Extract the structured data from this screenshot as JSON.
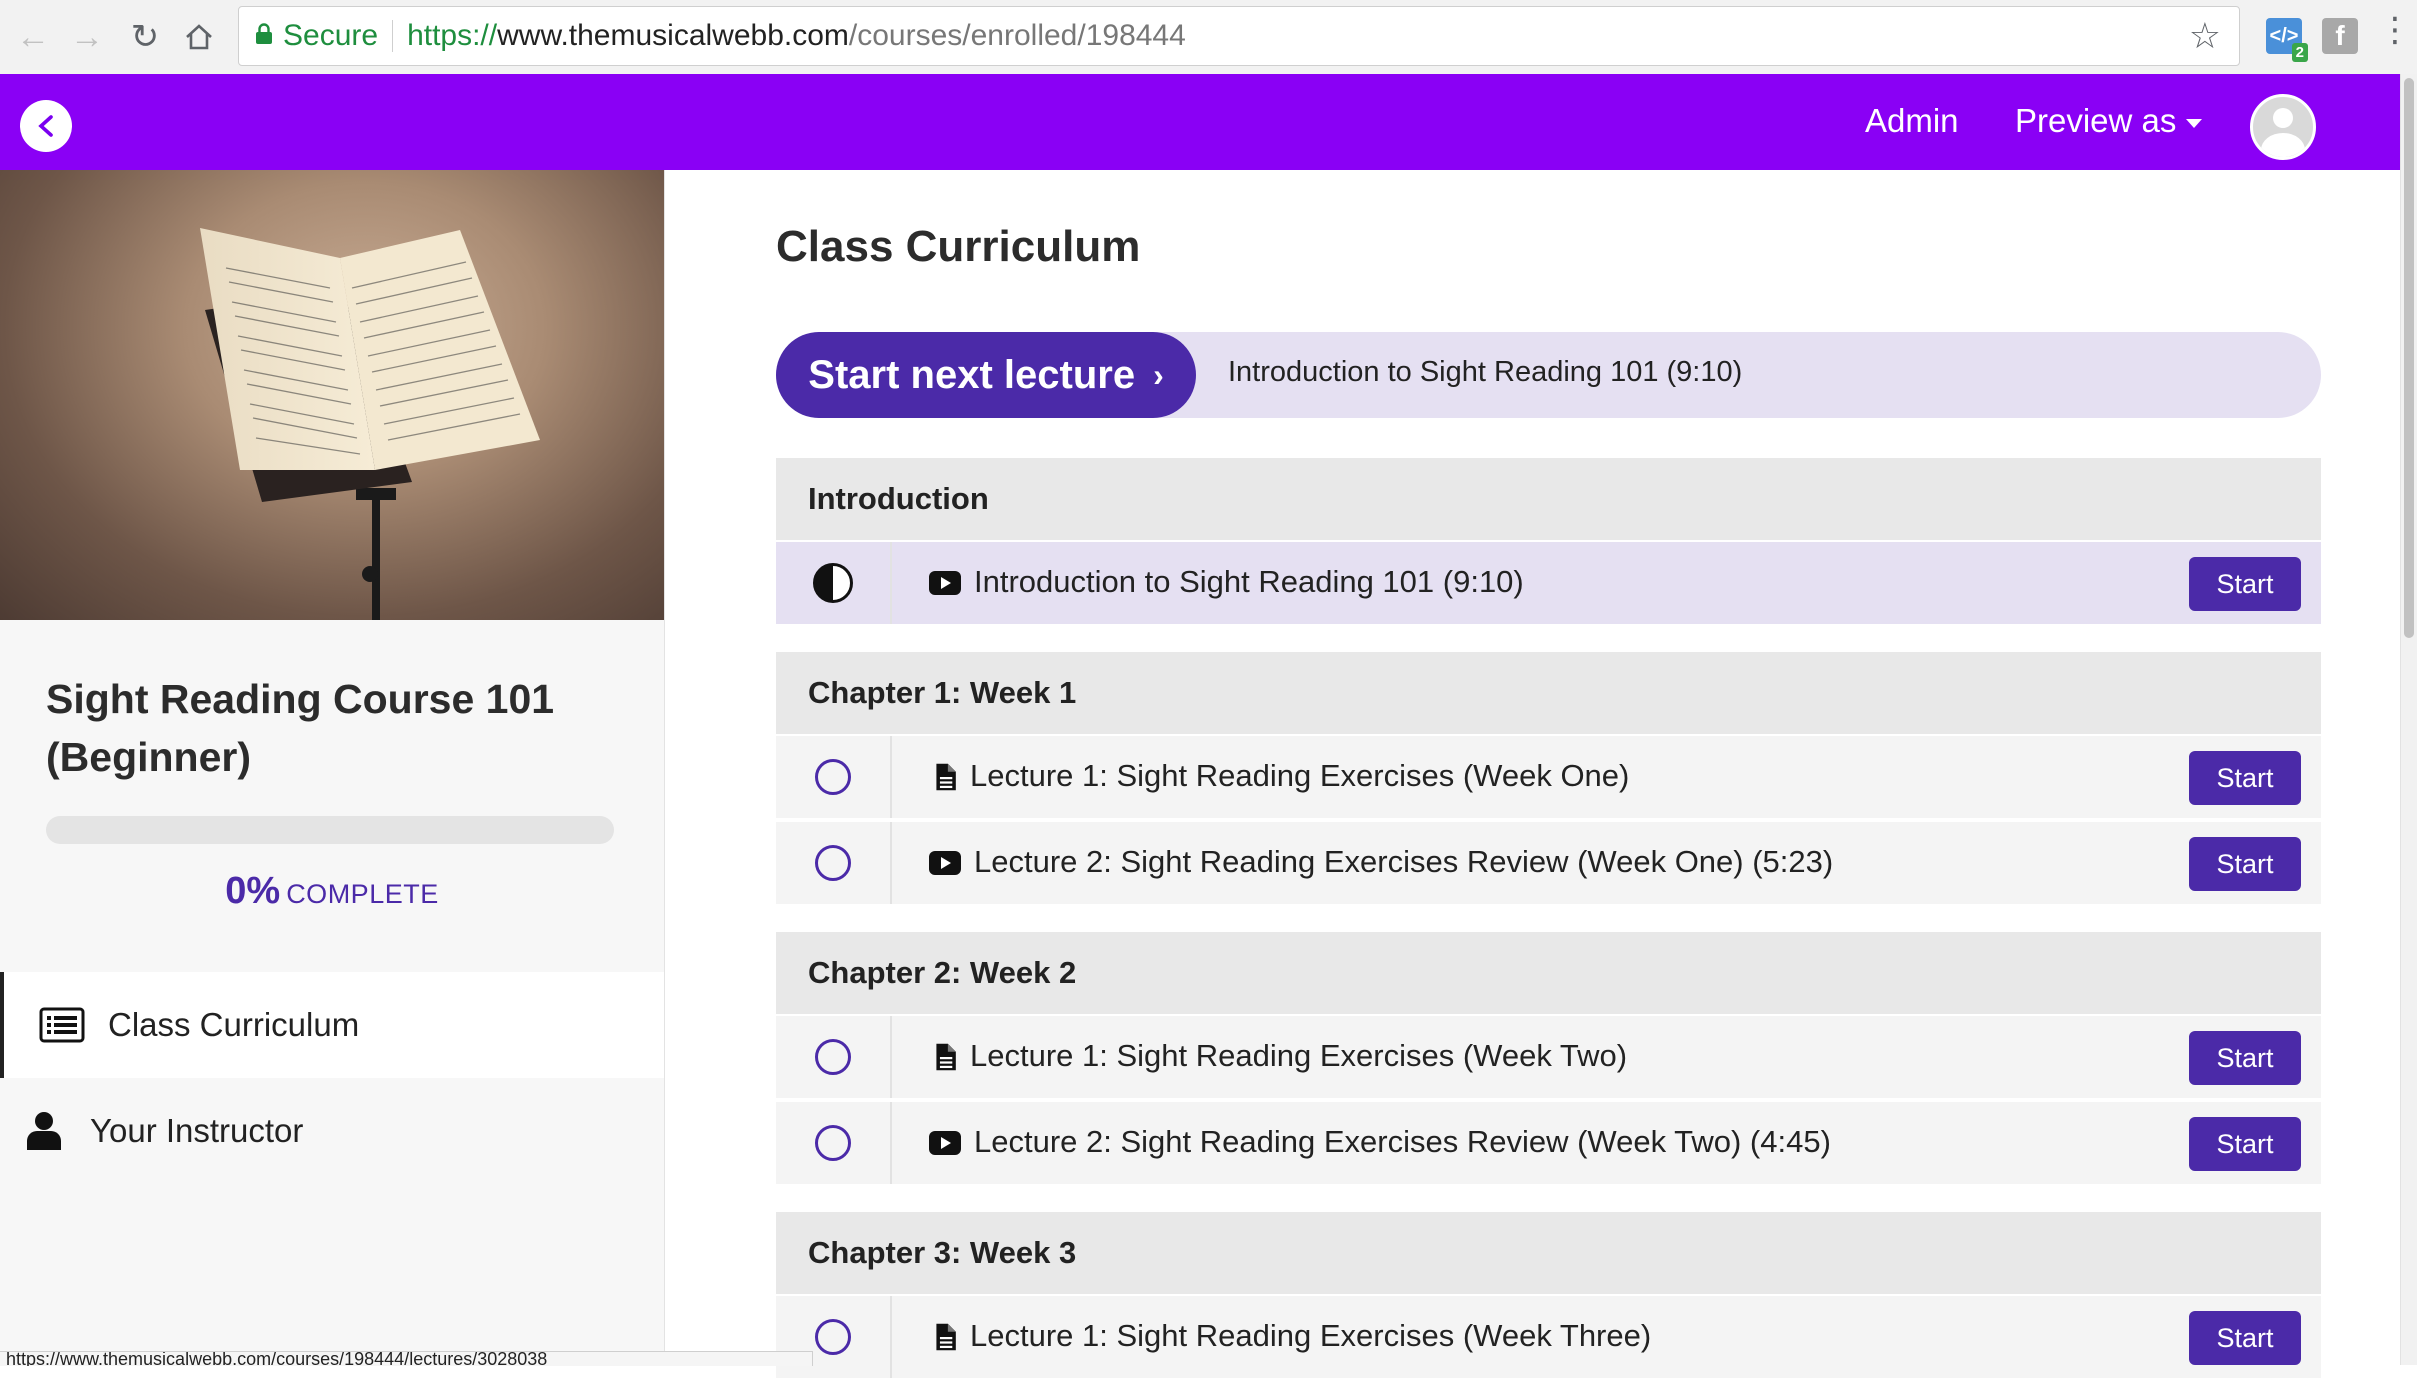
{
  "browser": {
    "secure_label": "Secure",
    "url_scheme": "https://",
    "url_host": "www.themusicalwebb.com",
    "url_path": "/courses/enrolled/198444",
    "ext_badge": "2",
    "status_url": "https://www.themusicalwebb.com/courses/198444/lectures/3028038"
  },
  "header": {
    "admin_label": "Admin",
    "preview_label": "Preview as",
    "brand_color": "#8a00f5"
  },
  "sidebar": {
    "course_title": "Sight Reading Course 101 (Beginner)",
    "progress_percent": 0,
    "progress_pct_text": "0%",
    "progress_label": "COMPLETE",
    "nav": [
      {
        "label": "Class Curriculum",
        "icon": "list-icon",
        "active": true
      },
      {
        "label": "Your Instructor",
        "icon": "user-icon",
        "active": false
      }
    ]
  },
  "main": {
    "title": "Class Curriculum",
    "next_button_label": "Start next lecture",
    "next_lecture_title": "Introduction to Sight Reading 101 (9:10)",
    "accent_color": "#4b2aa8",
    "sections": [
      {
        "name": "Introduction",
        "lectures": [
          {
            "title": "Introduction to Sight Reading 101 (9:10)",
            "type": "video-icon",
            "status": "half-complete",
            "button": "Start"
          }
        ]
      },
      {
        "name": "Chapter 1: Week 1",
        "lectures": [
          {
            "title": "Lecture 1: Sight Reading Exercises (Week One)",
            "type": "document-icon",
            "status": "not-started",
            "button": "Start"
          },
          {
            "title": "Lecture 2: Sight Reading Exercises Review (Week One) (5:23)",
            "type": "video-icon",
            "status": "not-started",
            "button": "Start"
          }
        ]
      },
      {
        "name": "Chapter 2: Week 2",
        "lectures": [
          {
            "title": "Lecture 1: Sight Reading Exercises (Week Two)",
            "type": "document-icon",
            "status": "not-started",
            "button": "Start"
          },
          {
            "title": "Lecture 2: Sight Reading Exercises Review (Week Two) (4:45)",
            "type": "video-icon",
            "status": "not-started",
            "button": "Start"
          }
        ]
      },
      {
        "name": "Chapter 3: Week 3",
        "lectures": [
          {
            "title": "Lecture 1: Sight Reading Exercises (Week Three)",
            "type": "document-icon",
            "status": "not-started",
            "button": "Start"
          }
        ]
      }
    ]
  }
}
